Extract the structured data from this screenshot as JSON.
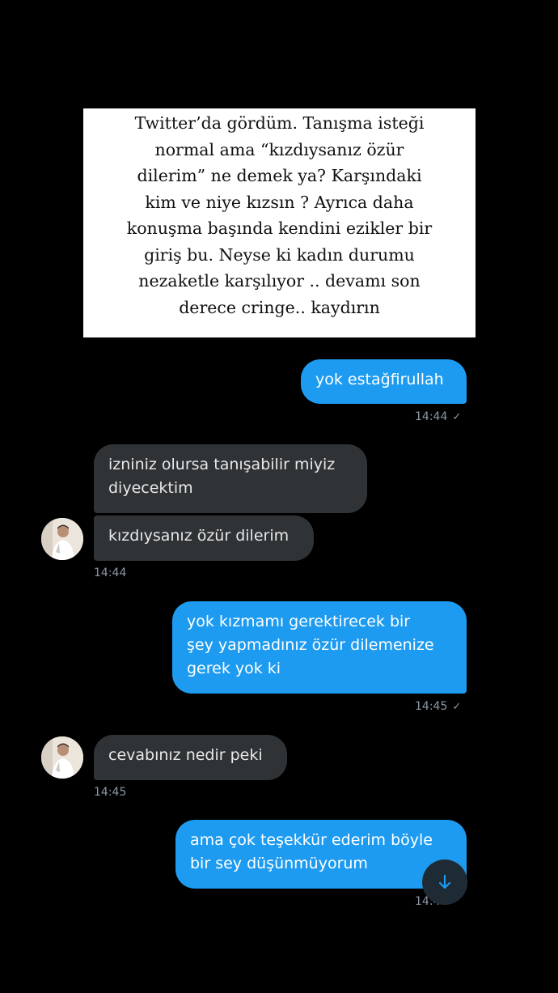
{
  "caption": {
    "lines": [
      "Twitter’da gördüm. Tanışma isteği",
      "normal ama “kızdıysanız özür",
      "dilerim” ne demek ya? Karşındaki",
      "kim ve niye kızsın ? Ayrıca daha",
      "konuşma başında kendini ezikler bir",
      "giriş bu. Neyse ki kadın durumu",
      "nezaketle karşılıyor .. devamı son",
      "derece cringe.. kaydırın"
    ]
  },
  "messages": {
    "m1": {
      "text": "yok estağfirullah",
      "time": "14:44"
    },
    "m2": {
      "lines": [
        "izniniz olursa tanışabilir miyiz",
        "diyecektim"
      ]
    },
    "m3": {
      "text": "kızdıysanız özür dilerim",
      "time": "14:44"
    },
    "m4": {
      "lines": [
        "yok kızmamı gerektirecek bir",
        "şey yapmadınız özür dilemenize",
        "gerek yok ki"
      ],
      "time": "14:45"
    },
    "m5": {
      "text": "cevabınız nedir peki",
      "time": "14:45"
    },
    "m6": {
      "lines": [
        "ama çok teşekkür ederim böyle",
        "bir sey düşünmüyorum"
      ],
      "time": "14:4"
    }
  },
  "icons": {
    "read_check": "✓",
    "scroll_down": "arrow-down-icon"
  },
  "colors": {
    "background": "#000000",
    "sent_bubble": "#1d9bf0",
    "received_bubble": "#2f3336",
    "timestamp": "#8b98a5"
  }
}
